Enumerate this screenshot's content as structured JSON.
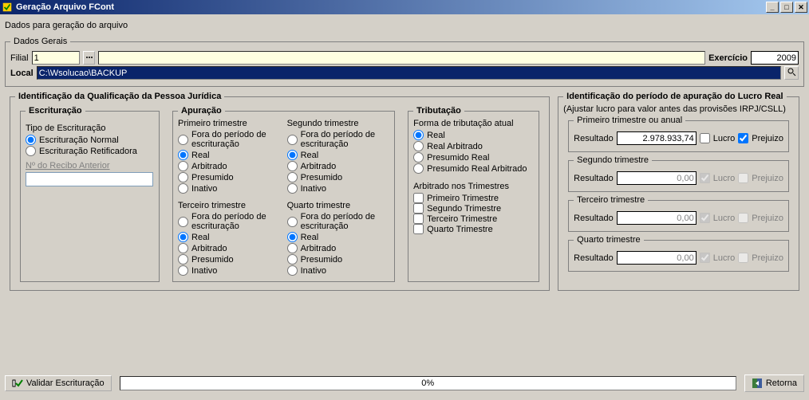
{
  "window": {
    "title": "Geração Arquivo FCont"
  },
  "subtitle": "Dados para geração do arquivo",
  "dados_gerais": {
    "legend": "Dados Gerais",
    "filial_lbl": "Filial",
    "filial_val": "1",
    "exercicio_lbl": "Exercício",
    "exercicio_val": "2009",
    "local_lbl": "Local",
    "local_val": "C:\\Wsolucao\\BACKUP"
  },
  "ident": {
    "legend": "Identificação da Qualificação da Pessoa Jurídica",
    "escrituracao": {
      "legend": "Escrituração",
      "tipo_lbl": "Tipo de Escrituração",
      "opts": [
        "Escrituração Normal",
        "Escrituração Retificadora"
      ],
      "recibo_lbl": "Nº do Recibo Anterior"
    },
    "apuracao": {
      "legend": "Apuração",
      "q1": "Primeiro trimestre",
      "q2": "Segundo trimestre",
      "q3": "Terceiro trimestre",
      "q4": "Quarto trimestre",
      "opts": [
        "Fora do período de escrituração",
        "Real",
        "Arbitrado",
        "Presumido",
        "Inativo"
      ]
    },
    "tributacao": {
      "legend": "Tributação",
      "forma_lbl": "Forma de tributação atual",
      "forma_opts": [
        "Real",
        "Real Arbitrado",
        "Presumido Real",
        "Presumido Real Arbitrado"
      ],
      "arb_lbl": "Arbitrado nos Trimestres",
      "arb_opts": [
        "Primeiro Trimestre",
        "Segundo Trimestre",
        "Terceiro Trimestre",
        "Quarto Trimestre"
      ]
    }
  },
  "periodo": {
    "legend": "Identificação do período de apuração do Lucro Real",
    "hint": "(Ajustar lucro para valor antes das provisões IRPJ/CSLL)",
    "q1": {
      "legend": "Primeiro trimestre ou anual",
      "res_lbl": "Resultado",
      "val": "2.978.933,74",
      "lucro": "Lucro",
      "prej": "Prejuizo"
    },
    "q2": {
      "legend": "Segundo trimestre",
      "res_lbl": "Resultado",
      "val": "0,00",
      "lucro": "Lucro",
      "prej": "Prejuizo"
    },
    "q3": {
      "legend": "Terceiro trimestre",
      "res_lbl": "Resultado",
      "val": "0,00",
      "lucro": "Lucro",
      "prej": "Prejuizo"
    },
    "q4": {
      "legend": "Quarto trimestre",
      "res_lbl": "Resultado",
      "val": "0,00",
      "lucro": "Lucro",
      "prej": "Prejuizo"
    }
  },
  "bottom": {
    "validar": "Validar Escrituração",
    "progress": "0%",
    "retorna": "Retorna"
  }
}
